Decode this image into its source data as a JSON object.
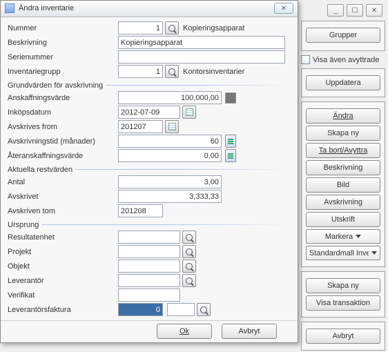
{
  "titlebar": {
    "min": "_",
    "max": "☐",
    "close": "✕"
  },
  "dialog": {
    "title": "Ändra inventarie",
    "close_glyph": "✕",
    "ok": "Ok",
    "cancel": "Avbryt"
  },
  "fields": {
    "nummer_label": "Nummer",
    "nummer_value": "1",
    "nummer_trailing": "Kopieringsapparat",
    "beskrivning_label": "Beskrivning",
    "beskrivning_value": "Kopieringsapparat",
    "serienummer_label": "Serienummer",
    "serienummer_value": "",
    "grupp_label": "Inventariegrupp",
    "grupp_value": "1",
    "grupp_trailing": "Kontorsinventarier"
  },
  "group1": "Grundvärden för avskrivning",
  "anskaff": {
    "label": "Anskaffningsvärde",
    "value": "100,000,00",
    "inkopsdatum_label": "Inköpsdatum",
    "inkopsdatum_value": "2012-07-09",
    "avskrives_label": "Avskrives from",
    "avskrives_value": "201207",
    "tid_label": "Avskrivningstid (månader)",
    "tid_value": "60",
    "ater_label": "Återanskaffningsvärde",
    "ater_value": "0,00"
  },
  "group2": "Aktuella restvärden",
  "rest": {
    "antal_label": "Antal",
    "antal_value": "3,00",
    "avskrivet_label": "Avskrivet",
    "avskrivet_value": "3,333,33",
    "avtom_label": "Avskriven tom",
    "avtom_value": "201208"
  },
  "group3": "Ursprung",
  "ursprung": {
    "resultat_label": "Resultatenhet",
    "projekt_label": "Projekt",
    "objekt_label": "Objekt",
    "lever_label": "Leverantör",
    "verifikat_label": "Verifikat",
    "faktura_label": "Leverantörsfaktura",
    "faktura_value": "0",
    "faktura_value2": ""
  },
  "right": {
    "grupper": "Grupper",
    "visa_even": "Visa även avyttrade",
    "uppdatera": "Uppdatera",
    "andra": "Ändra",
    "skapa_ny": "Skapa ny",
    "tabort": "Ta bort/Avyttra",
    "beskrivning": "Beskrivning",
    "bild": "Bild",
    "avskrivning": "Avskrivning",
    "utskrift": "Utskrift",
    "markera": "Markera",
    "standardmall": "Standardmall Inven",
    "skapa_ny2": "Skapa ny",
    "visa_trans": "Visa transaktion",
    "avbryt": "Avbryt",
    "arrow_up": "▲",
    "arrow_down": "▼"
  }
}
